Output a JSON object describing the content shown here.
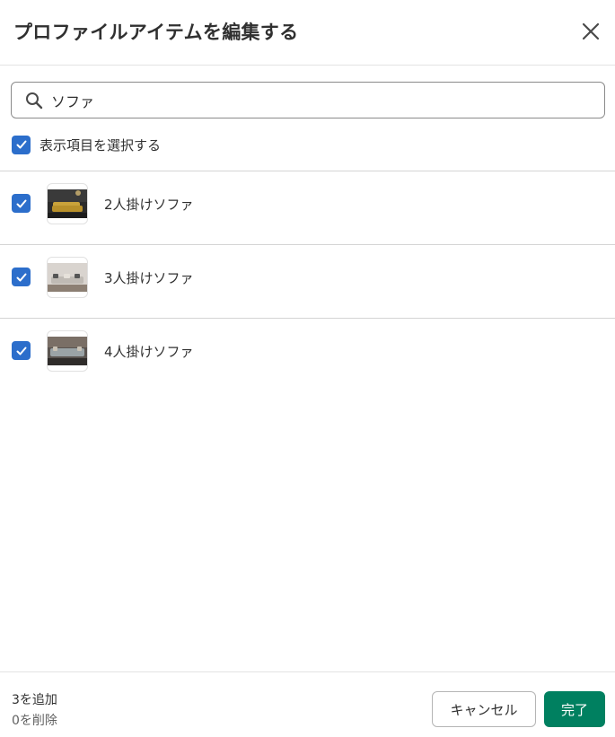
{
  "modal": {
    "title": "プロファイルアイテムを編集する",
    "close_icon": "close-icon"
  },
  "search": {
    "value": "ソファ",
    "icon": "search-icon"
  },
  "select_all": {
    "label": "表示項目を選択する",
    "checked": true
  },
  "items": [
    {
      "label": "2人掛けソファ",
      "checked": true,
      "thumbnail_icon": "sofa-photo-icon"
    },
    {
      "label": "3人掛けソファ",
      "checked": true,
      "thumbnail_icon": "sofa-photo-icon"
    },
    {
      "label": "4人掛けソファ",
      "checked": true,
      "thumbnail_icon": "sofa-photo-icon"
    }
  ],
  "footer": {
    "added": "3を追加",
    "removed": "0を削除",
    "cancel_label": "キャンセル",
    "done_label": "完了"
  },
  "colors": {
    "checkbox": "#2c6ecb",
    "primary_button": "#008060"
  }
}
